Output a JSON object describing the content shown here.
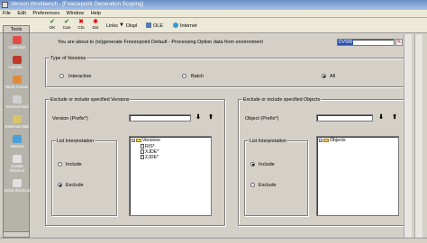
{
  "window": {
    "title": "Version Workbench - [Freezepoint Generation Scoping]"
  },
  "menu": [
    "File",
    "Edit",
    "Preferences",
    "Window",
    "Help"
  ],
  "toolbar": {
    "ok": "OK",
    "cancel": "Can",
    "close": "Clo",
    "display": "Dis",
    "links": "Links",
    "disp": "Displ",
    "ole": "OLE",
    "internet": "Internet"
  },
  "sidebar": {
    "header": "Tools",
    "items": [
      "Calendar",
      "Calcula...",
      "Work Center",
      "Internal Mail",
      "External Mail",
      "Internet",
      "Create Shortcut",
      "Send Shortcut"
    ]
  },
  "main": {
    "message": "You are about to (re)generate Freezepoint Default - Processing Option data from environment",
    "env_value": "DV900",
    "type_group": {
      "label": "Type of Versions",
      "options": [
        "Interactive",
        "Batch",
        "All"
      ],
      "selected": "All"
    },
    "versions_group": {
      "label": "Exclude or include specified Versions",
      "field_label": "Version (Prefix*)",
      "field_value": "",
      "list_label": "List Interpretation",
      "options": [
        "Include",
        "Exclude"
      ],
      "selected": "Exclude",
      "tree_root": "Versions",
      "tree_items": [
        "RIS*",
        "XJDE*",
        "ZJDE*"
      ]
    },
    "objects_group": {
      "label": "Exclude or include specified Objects",
      "field_label": "Object (Prefix*)",
      "field_value": "",
      "list_label": "List Interpretation",
      "options": [
        "Include",
        "Exclude"
      ],
      "selected": "Include",
      "tree_root": "Objects"
    }
  }
}
